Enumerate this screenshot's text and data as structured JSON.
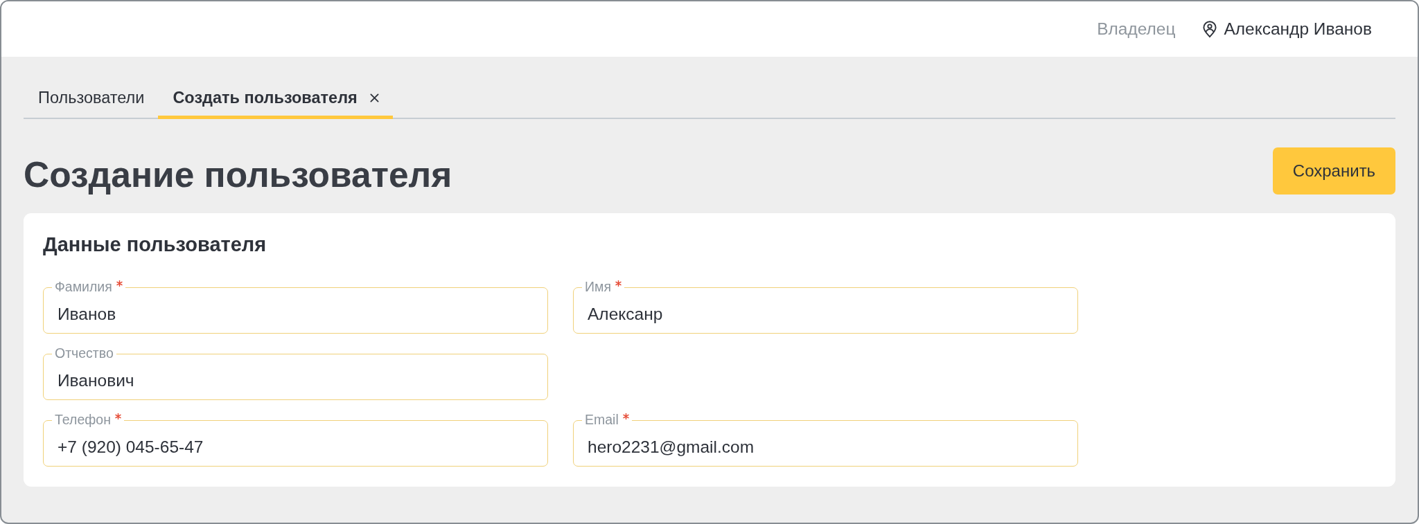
{
  "header": {
    "role": "Владелец",
    "user": "Александр Иванов"
  },
  "tabs": [
    {
      "label": "Пользователи",
      "selected": false,
      "closable": false
    },
    {
      "label": "Создать пользователя",
      "selected": true,
      "closable": true
    }
  ],
  "page": {
    "title": "Создание пользователя",
    "save_button": "Сохранить"
  },
  "card": {
    "title": "Данные пользователя",
    "rows": [
      [
        {
          "label": "Фамилия",
          "required": true,
          "value": "Иванов"
        },
        {
          "label": "Имя",
          "required": true,
          "value": "Алексанр"
        }
      ],
      [
        {
          "label": "Отчество",
          "required": false,
          "value": "Иванович"
        }
      ],
      [
        {
          "label": "Телефон",
          "required": true,
          "value": "+7 (920) 045-65-47"
        },
        {
          "label": "Email",
          "required": true,
          "value": "hero2231@gmail.com"
        }
      ]
    ]
  }
}
